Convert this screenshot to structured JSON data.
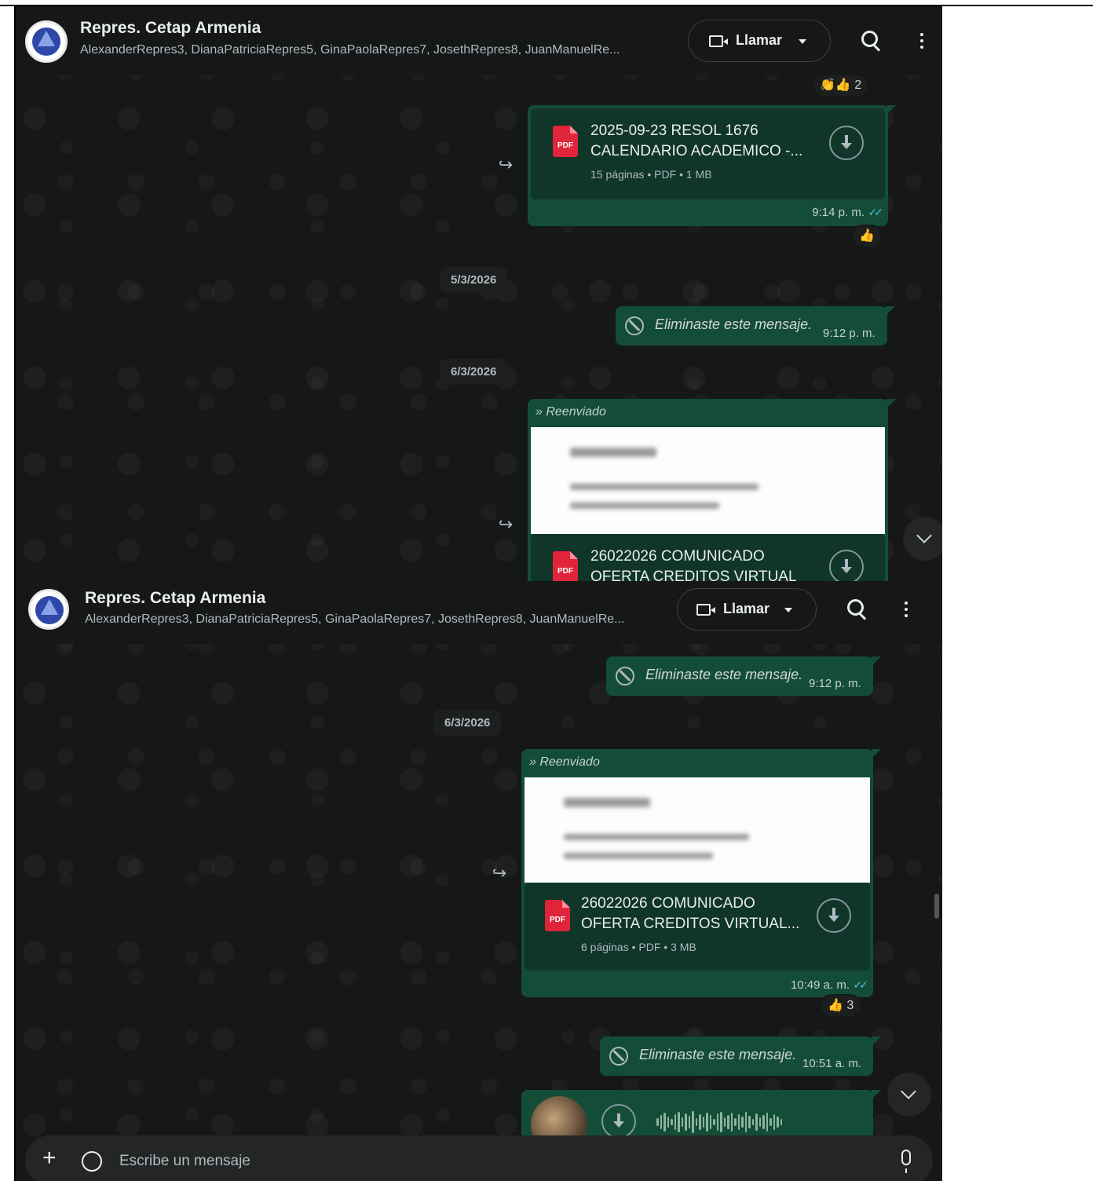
{
  "chat": {
    "title": "Repres. Cetap Armenia",
    "members": "AlexanderRepres3, DianaPatriciaRepres5, GinaPaolaRepres7, JosethRepres8, JuanManuelRe...",
    "call_label": "Llamar"
  },
  "shot1": {
    "top_reaction": "👏👍 2",
    "doc1": {
      "name_line1": "2025-09-23 RESOL 1676",
      "name_line2": "CALENDARIO ACADEMICO -...",
      "meta": "15 páginas • PDF • 1 MB",
      "time": "9:14 p. m.",
      "reaction": "👍"
    },
    "date1": "5/3/2026",
    "deleted1": {
      "text": "Eliminaste este mensaje.",
      "time": "9:12 p. m."
    },
    "date2": "6/3/2026",
    "forwarded": {
      "label": "Reenviado",
      "doc_line1": "26022026 COMUNICADO",
      "doc_line2": "OFERTA CREDITOS VIRTUAL"
    }
  },
  "shot2": {
    "deleted1": {
      "text": "Eliminaste este mensaje.",
      "time": "9:12 p. m."
    },
    "date": "6/3/2026",
    "forwarded": {
      "label": "Reenviado",
      "doc_line1": "26022026 COMUNICADO",
      "doc_line2": "OFERTA CREDITOS VIRTUAL...",
      "meta": "6 páginas • PDF • 3 MB",
      "time": "10:49 a. m.",
      "reaction": "👍 3"
    },
    "deleted2": {
      "text": "Eliminaste este mensaje.",
      "time": "10:51 a. m."
    },
    "composer_placeholder": "Escribe un mensaje"
  },
  "icons": {
    "pdf": "PDF",
    "forward": "↪",
    "ticks": "✓✓",
    "plus": "+"
  },
  "colors": {
    "background": "#161717",
    "outgoing_bubble": "#144d37",
    "read_ticks": "#53bdeb",
    "pdf_red": "#e0243a"
  }
}
